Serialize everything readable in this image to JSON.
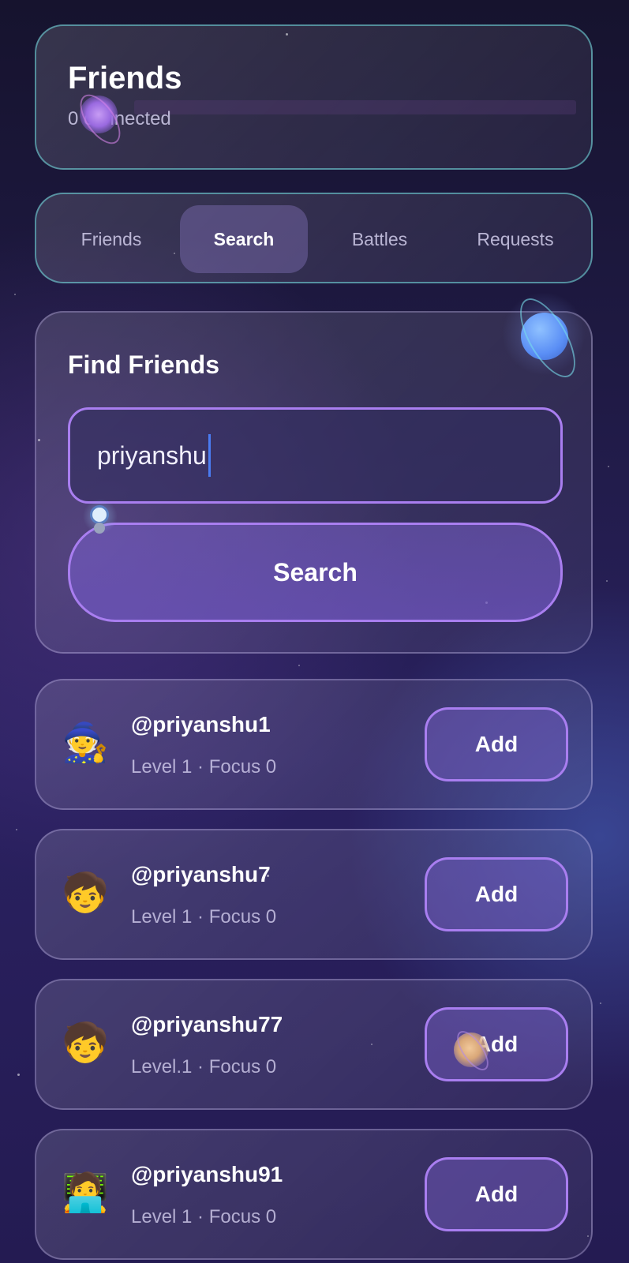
{
  "header": {
    "title": "Friends",
    "subtitle": "0 connected"
  },
  "tabs": [
    {
      "label": "Friends",
      "active": false
    },
    {
      "label": "Search",
      "active": true
    },
    {
      "label": "Battles",
      "active": false
    },
    {
      "label": "Requests",
      "active": false
    }
  ],
  "find": {
    "title": "Find Friends",
    "query": "priyanshu",
    "search_label": "Search"
  },
  "results": [
    {
      "username": "@priyanshu1",
      "meta": "Level 1 · Focus 0",
      "avatar": "🧙",
      "avatar_icon": "wizard-avatar-icon",
      "action": "Add"
    },
    {
      "username": "@priyanshu7",
      "meta": "Level 1 · Focus 0",
      "avatar": "🧒",
      "avatar_icon": "child-avatar-icon",
      "action": "Add"
    },
    {
      "username": "@priyanshu77",
      "meta": "Level.1 · Focus 0",
      "avatar": "🧒",
      "avatar_icon": "child-avatar-icon",
      "action": "Add"
    },
    {
      "username": "@priyanshu91",
      "meta": "Level 1 · Focus 0",
      "avatar": "🧑‍💻",
      "avatar_icon": "coder-avatar-icon",
      "action": "Add"
    }
  ],
  "colors": {
    "accent": "#a97ef0",
    "caret": "#4a7cf2",
    "teal_border": "#6ed2d7"
  }
}
